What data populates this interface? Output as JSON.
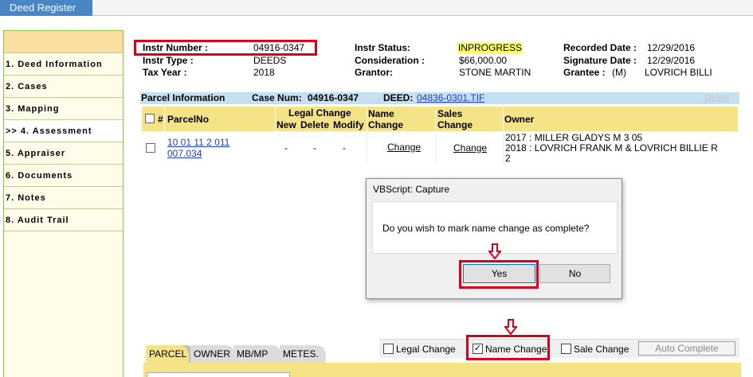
{
  "app": {
    "tab_label": "Deed Register"
  },
  "sidebar": {
    "items": [
      {
        "label": "1. Deed Information"
      },
      {
        "label": "2. Cases"
      },
      {
        "label": "3. Mapping"
      },
      {
        "label": ">> 4. Assessment"
      },
      {
        "label": "5. Appraiser"
      },
      {
        "label": "6. Documents"
      },
      {
        "label": "7. Notes"
      },
      {
        "label": "8. Audit Trail"
      }
    ]
  },
  "header": {
    "instr_number_label": "Instr Number :",
    "instr_number": "04916-0347",
    "instr_type_label": "Instr Type :",
    "instr_type": "DEEDS",
    "tax_year_label": "Tax Year :",
    "tax_year": "2018",
    "instr_status_label": "Instr Status:",
    "instr_status": "INPROGRESS",
    "consideration_label": "Consideration :",
    "consideration": "$66,000.00",
    "grantor_label": "Grantor:",
    "grantor": "STONE MARTIN",
    "recorded_date_label": "Recorded Date :",
    "recorded_date": "12/29/2016",
    "signature_date_label": "Signature Date :",
    "signature_date": "12/29/2016",
    "grantee_label": "Grantee :",
    "grantee_flag": "(M)",
    "grantee": "LOVRICH BILLI"
  },
  "parcel_info": {
    "title": "Parcel Information",
    "case_num_label": "Case Num:",
    "case_num": "04916-0347",
    "deed_label": "DEED:",
    "deed_link": "04836-0301.TIF",
    "delete_label": "Delete"
  },
  "grid": {
    "headers": {
      "hash": "#",
      "parcel_no": "ParcelNo",
      "legal_change": "Legal Change",
      "new": "New",
      "delete": "Delete",
      "modify": "Modify",
      "name_change_1": "Name",
      "name_change_2": "Change",
      "sales_change_1": "Sales",
      "sales_change_2": "Change",
      "owner": "Owner"
    },
    "rows": [
      {
        "parcel_line1": "10 01 11 2 011",
        "parcel_line2": "007.034",
        "new": "-",
        "delete": "-",
        "modify": "-",
        "name_change": "Change",
        "sales_change": "Change",
        "owner_line1": "2017 :  MILLER GLADYS M  3  05",
        "owner_line2": "2018 :  LOVRICH FRANK M & LOVRICH BILLIE R",
        "owner_line3": "2"
      }
    ]
  },
  "dialog": {
    "title": "VBScript: Capture",
    "message": "Do you wish to mark name change as complete?",
    "yes_label": "Yes",
    "no_label": "No"
  },
  "bottom_tabs": [
    {
      "label": "PARCEL"
    },
    {
      "label": "OWNER"
    },
    {
      "label": "MB/MP"
    },
    {
      "label": "METES."
    }
  ],
  "status_panel": {
    "legal_change_label": "Legal Change",
    "legal_change_checked": false,
    "name_change_label": "Name Change",
    "name_change_checked": true,
    "name_change_mark": "✓",
    "sale_change_label": "Sale Change",
    "sale_change_checked": false,
    "auto_complete_label": "Auto Complete"
  },
  "colors": {
    "tab_blue": "#4a86c6",
    "highlight_red": "#d9001b",
    "grid_header_yellow": "#f5e388",
    "parcel_strip_blue": "#c5dff3",
    "status_highlight": "#ffff66"
  }
}
